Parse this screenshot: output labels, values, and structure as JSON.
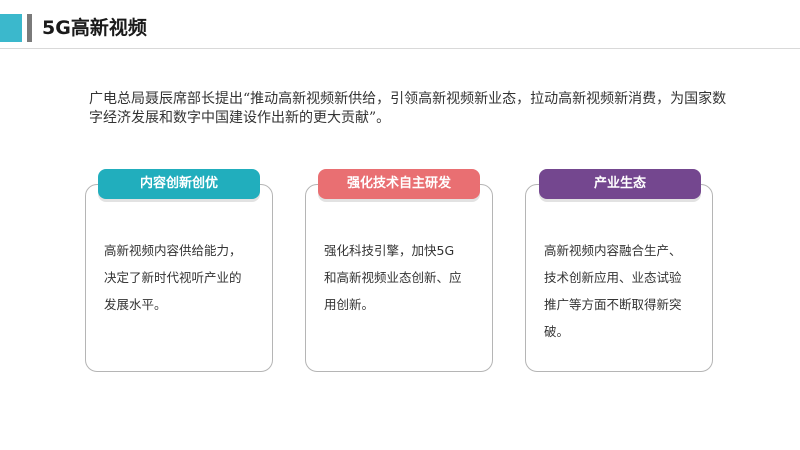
{
  "header": {
    "title": "5G高新视频",
    "accent_color": "#3bb8cc"
  },
  "intro": {
    "text": "广电总局聂辰席部长提出“推动高新视频新供给，引领高新视频新业态，拉动高新视频新消费，为国家数字经济发展和数字中国建设作出新的更大贡献”。"
  },
  "cards": [
    {
      "title": "内容创新创优",
      "color": "#21aebd",
      "lines": [
        "高新视频内容供给能力，",
        "决定了新时代视听产业的",
        "发展水平。"
      ]
    },
    {
      "title": "强化技术自主研发",
      "color": "#e96f72",
      "lines": [
        "强化科技引擎，加快5G",
        "和高新视频业态创新、应",
        "用创新。"
      ]
    },
    {
      "title": "产业生态",
      "color": "#74478f",
      "lines": [
        "高新视频内容融合生产、",
        "技术创新应用、业态试验",
        "推广等方面不断取得新突",
        "破。"
      ]
    }
  ]
}
